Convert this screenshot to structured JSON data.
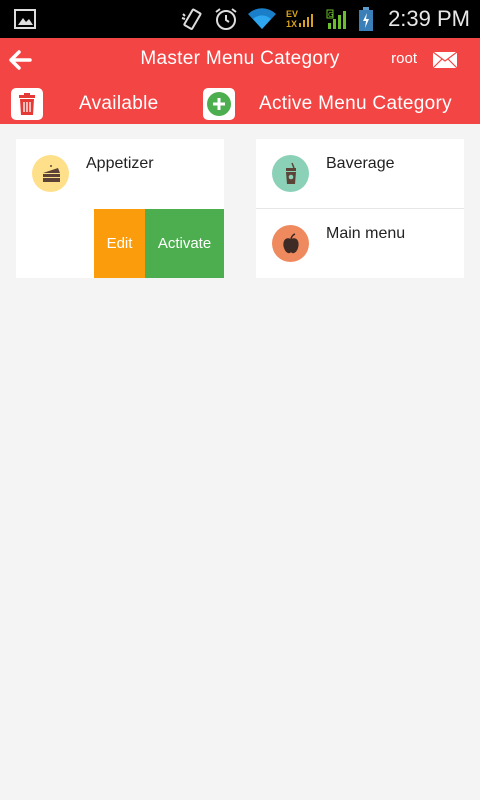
{
  "status_bar": {
    "time": "2:39 PM",
    "network_label_top": "EV",
    "network_label_bottom": "1X",
    "signal_label": "G"
  },
  "app_bar": {
    "title": "Master Menu Category",
    "user": "root",
    "available_label": "Available",
    "active_label": "Active Menu Category"
  },
  "available": {
    "items": [
      {
        "label": "Appetizer",
        "icon": "cake-icon",
        "icon_color": "#ffe08a"
      }
    ],
    "swipe_actions": {
      "edit_label": "Edit",
      "activate_label": "Activate"
    }
  },
  "active": {
    "items": [
      {
        "label": "Baverage",
        "icon": "drink-icon",
        "icon_color": "#8bd1b7"
      },
      {
        "label": "Main menu",
        "icon": "apple-icon",
        "icon_color": "#ef8a5f"
      }
    ]
  },
  "colors": {
    "accent": "#f44545",
    "edit": "#fb9c0d",
    "activate": "#4cae4f",
    "background": "#f4f4f4"
  }
}
